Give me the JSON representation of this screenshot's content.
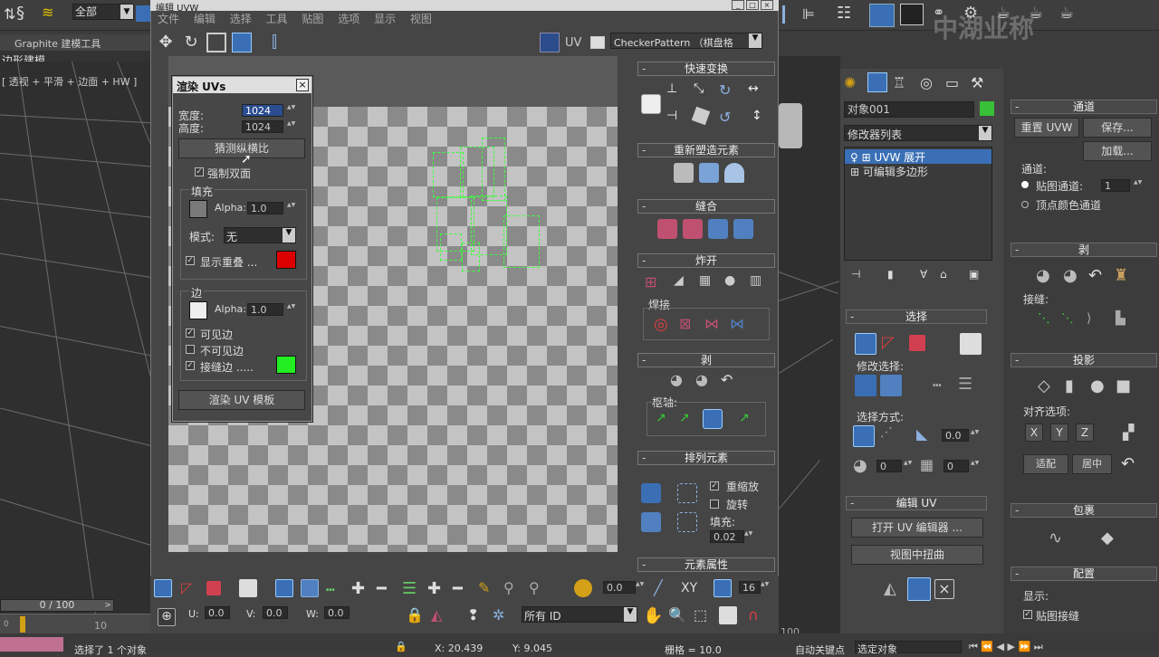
{
  "topbar": {
    "selection_filter": "全部"
  },
  "watermark": "中湖业称",
  "left_panel": {
    "graphite": "Graphite 建模工具",
    "edge_model": "边形建模",
    "viewport_label": "[ 透视 + 平滑 + 边面 + HW ]",
    "timeline": "0 / 100",
    "ruler_start": "0",
    "ruler_10": "10",
    "ruler_100": "100"
  },
  "uv_editor": {
    "title": "编辑 UVW",
    "menus": [
      "文件",
      "编辑",
      "选择",
      "工具",
      "贴图",
      "选项",
      "显示",
      "视图"
    ],
    "uv_label": "UV",
    "checker_dropdown": "CheckerPattern （棋盘格",
    "bottom": {
      "u_label": "U:",
      "u_value": "0.0",
      "v_label": "V:",
      "v_value": "0.0",
      "w_label": "W:",
      "w_value": "0.0",
      "spin_a": "0.0",
      "spin_b": "16",
      "xy_label": "XY",
      "all_id": "所有 ID"
    }
  },
  "render_dialog": {
    "title": "渲染 UVs",
    "width_label": "宽度:",
    "width_value": "1024",
    "height_label": "高度:",
    "height_value": "1024",
    "guess_button": "猜测纵横比",
    "force_label": "强制双面",
    "fill_group": "填充",
    "alpha_label": "Alpha:",
    "fill_alpha": "1.0",
    "mode_label": "模式:",
    "mode_value": "无",
    "show_overlap": "显示重叠 ...",
    "edge_group": "边",
    "edge_alpha": "1.0",
    "visible_edges": "可见边",
    "invisible_edges": "不可见边",
    "seam_edges": "接缝边 .....",
    "render_button": "渲染 UV 模板",
    "colors": {
      "fill": "#7a7a7a",
      "overlap": "#dd0000",
      "edge": "#eeeeee",
      "seam": "#22ee22"
    }
  },
  "right_rollouts": {
    "quick_transform": "快速变换",
    "reshape": "重新塑造元素",
    "stitch": "缝合",
    "explode": "炸开",
    "weld": "焊接",
    "peel": "剥",
    "pivot": "枢轴:",
    "arrange": "排列元素",
    "rescale": "重缩放",
    "rotate": "旋转",
    "padding_label": "填充:",
    "padding_value": "0.02",
    "element_props": "元素属性"
  },
  "command_panel": {
    "object_name": "对象001",
    "modifier_list": "修改器列表",
    "stack": [
      "UVW 展开",
      "可编辑多边形"
    ],
    "selection": "选择",
    "modify_selection": "修改选择:",
    "selection_method": "选择方式:",
    "sel_value_a": "0.0",
    "sel_value_b": "0",
    "sel_value_c": "0",
    "edit_uv": "编辑 UV",
    "open_uv_editor": "打开 UV 编辑器 ...",
    "tweak_in_view": "视图中扭曲",
    "channel": "通道",
    "reset_uvw": "重置 UVW",
    "save": "保存...",
    "load": "加载...",
    "channel_label": "通道:",
    "map_channel": "贴图通道:",
    "map_channel_value": "1",
    "vertex_color_channel": "顶点颜色通道",
    "peel": "剥",
    "seams": "接缝:",
    "projection": "投影",
    "align_options": "对齐选项:",
    "axis_x": "X",
    "axis_y": "Y",
    "axis_z": "Z",
    "fit": "适配",
    "center": "居中",
    "wrap": "包裹",
    "config": "配置",
    "display": "显示:",
    "map_seams": "贴图接缝"
  },
  "status": {
    "selected": "选择了 1 个对象",
    "x_value": "X: 20.439",
    "y_value": "Y: 9.045",
    "grid": "栅格 = 10.0",
    "auto_key": "自动关键点",
    "selected_obj": "选定对象"
  }
}
